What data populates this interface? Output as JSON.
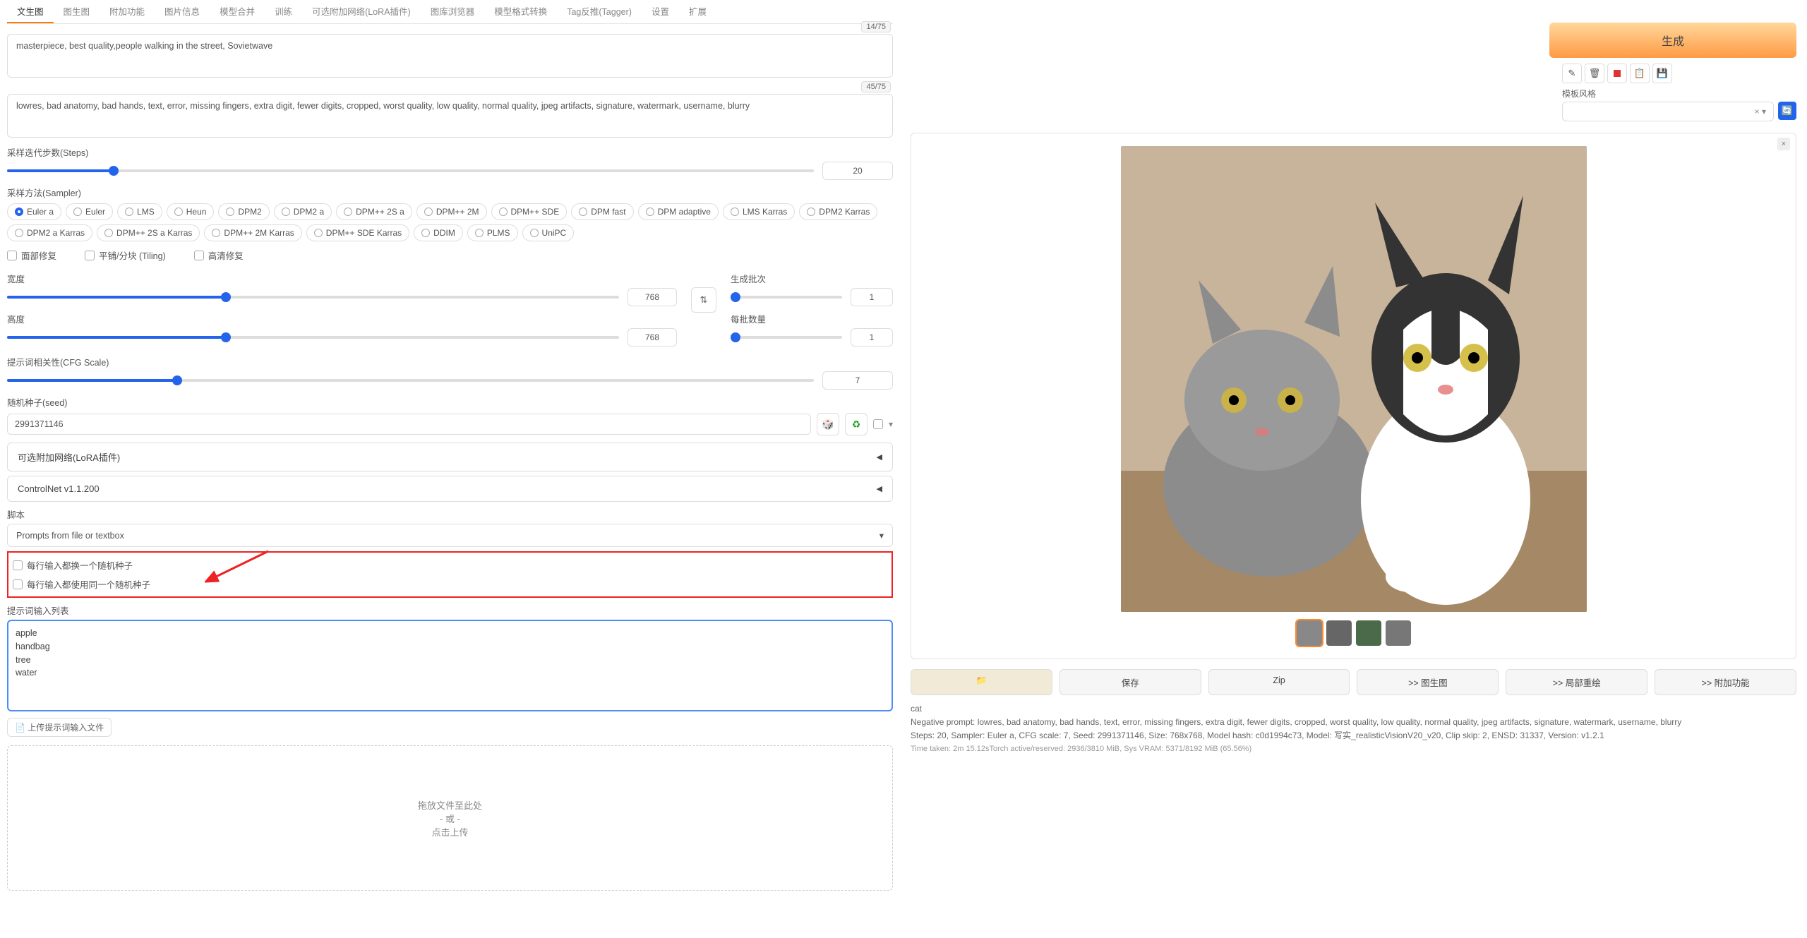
{
  "tabs": [
    "文生图",
    "图生图",
    "附加功能",
    "图片信息",
    "模型合并",
    "训练",
    "可选附加网络(LoRA插件)",
    "图库浏览器",
    "模型格式转换",
    "Tag反推(Tagger)",
    "设置",
    "扩展"
  ],
  "active_tab": 0,
  "prompt": {
    "text": "masterpiece, best quality,people walking in the street, Sovietwave",
    "counter": "14/75"
  },
  "neg_prompt": {
    "text": "lowres, bad anatomy, bad hands, text, error, missing fingers, extra digit, fewer digits, cropped, worst quality, low quality, normal quality, jpeg artifacts, signature, watermark, username, blurry",
    "counter": "45/75"
  },
  "steps": {
    "label": "采样迭代步数(Steps)",
    "value": 20
  },
  "sampler_label": "采样方法(Sampler)",
  "samplers": [
    "Euler a",
    "Euler",
    "LMS",
    "Heun",
    "DPM2",
    "DPM2 a",
    "DPM++ 2S a",
    "DPM++ 2M",
    "DPM++ SDE",
    "DPM fast",
    "DPM adaptive",
    "LMS Karras",
    "DPM2 Karras",
    "DPM2 a Karras",
    "DPM++ 2S a Karras",
    "DPM++ 2M Karras",
    "DPM++ SDE Karras",
    "DDIM",
    "PLMS",
    "UniPC"
  ],
  "sampler_selected": "Euler a",
  "checks": {
    "face": "面部修复",
    "tiling": "平铺/分块 (Tiling)",
    "hires": "高清修复"
  },
  "width": {
    "label": "宽度",
    "value": 768
  },
  "height": {
    "label": "高度",
    "value": 768
  },
  "batch_count": {
    "label": "生成批次",
    "value": 1
  },
  "batch_size": {
    "label": "每批数量",
    "value": 1
  },
  "cfg": {
    "label": "提示词相关性(CFG Scale)",
    "value": 7
  },
  "seed": {
    "label": "随机种子(seed)",
    "value": "2991371146"
  },
  "swap_icon": "⇅",
  "dice_icon": "🎲",
  "recycle_icon": "♻",
  "dropdown_caret": "▾",
  "accordions": {
    "lora": "可选附加网络(LoRA插件)",
    "controlnet": "ControlNet v1.1.200"
  },
  "accordion_caret": "◀",
  "script": {
    "label": "脚本",
    "selected": "Prompts from file or textbox"
  },
  "script_opts": {
    "iterate": "每行输入都换一个随机种子",
    "same": "每行输入都使用同一个随机种子"
  },
  "prompt_list": {
    "label": "提示词输入列表",
    "value": "apple\nhandbag\ntree\nwater"
  },
  "upload_label": "📄 上传提示词输入文件",
  "dropzone": {
    "l1": "拖放文件至此处",
    "l2": "- 或 -",
    "l3": "点击上传"
  },
  "generate": "生成",
  "style_label": "模板风格",
  "style_clear": "×  ▾",
  "refresh_icon": "🔄",
  "close_icon": "×",
  "actions": {
    "folder": "📁",
    "save": "保存",
    "zip": "Zip",
    "img2img": ">> 图生图",
    "inpaint": ">> 局部重绘",
    "extras": ">> 附加功能"
  },
  "gen_info": {
    "l1": "cat",
    "l2": "Negative prompt: lowres, bad anatomy, bad hands, text, error, missing fingers, extra digit, fewer digits, cropped, worst quality, low quality, normal quality, jpeg artifacts, signature, watermark, username, blurry",
    "l3": "Steps: 20, Sampler: Euler a, CFG scale: 7, Seed: 2991371146, Size: 768x768, Model hash: c0d1994c73, Model: 写实_realisticVisionV20_v20, Clip skip: 2, ENSD: 31337, Version: v1.2.1",
    "l4": "Time taken: 2m 15.12sTorch active/reserved: 2936/3810 MiB, Sys VRAM: 5371/8192 MiB (65.56%)"
  },
  "tool_icons": [
    "✎",
    "🗑",
    "■",
    "📋",
    "💾"
  ]
}
